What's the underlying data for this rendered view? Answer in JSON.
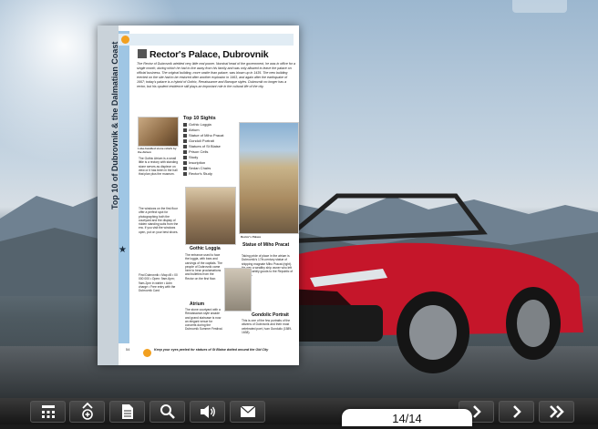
{
  "book": {
    "section_title": "Top 10 of Dubrovnik & the Dalmatian Coast",
    "heading": "Rector's Palace, Dubrovnik",
    "intro": "The Rector of Dubrovnik wielded very little real power. Nominal head of the government, he was in office for a single month, during which he had to live away from his family and was only allowed to leave the palace on official business. The original building, more castle than palace, was blown up in 1435. The new building erected on the site had to be restored after another explosion in 1463, and again after the earthquake of 1667; today's palace is a hybrid of Gothic, Renaissance and Baroque styles. Dubrovnik no longer has a rector, but his opulent residence still plays an important role in the cultural life of the city.",
    "top_sights_heading": "Top 10 Sights",
    "top_sights": [
      "Gothic Loggia",
      "Atrium",
      "Statue of Miho Pracat",
      "Gondoli Portrait",
      "Statues of St Blaise",
      "Prison Cells",
      "Study",
      "Inscription",
      "Sedan Chairs",
      "Rector's Study"
    ],
    "left_col_1": "The Gothic Atrium is a small little is a rectory with standing stone serves as dispiece on view or it has been in the hall that plan plus the museum.",
    "left_col_2": "The windows on the first floor offer a perfect spot for photographing both the courtyard and the display of ridden standing suits from the era. If you visit the windows open, put on your best shoes.",
    "left_col_3": "Find Dubrovnik • Map d5 • 00 000 000 • Open: 9am-6pm; 9am-2pm in winter • Adm charge • Free entry with the Dubrovnik Card",
    "caption_arch": "Lobe-handled stone reliefs by the Atrium",
    "caption_palace": "Rector's Palace",
    "gothic_loggia_h": "Gothic Loggia",
    "gothic_loggia_t": "The entrance used to face the loggia, with bars and carvings of the capitals. The people of Dubrovnik came here to hear proclamations and bulletins from the Rector on the first floor.",
    "atrium_h": "Atrium",
    "atrium_t": "The stone courtyard with a Renaissance-style arcade and grand staircase is now an elegant venue for concerts during the Dubrovnik Summer Festival.",
    "statue_h": "Statue of Miho Pracat",
    "statue_t": "Taking pride of place in the atrium is Dubrovnik's 17th-century statue of shipping magnate Miho Pracat (right). He was a wealthy ship owner who left all his worldly goods to the Republic of Ragusa.",
    "portrait_h": "Gondolic Portrait",
    "portrait_t": "This is one of the few portraits of the citizens of Dubrovnik and their most celebrated poet, Ivan Gundulic (1589-1638).",
    "page_number": "54",
    "footer_note": "Keep your eyes peeled for statues of St Blaise dotted around the Old City"
  },
  "toolbar": {
    "buttons": [
      "thumbnails",
      "zoom-in",
      "text",
      "search",
      "sound",
      "share"
    ],
    "nav_buttons": [
      "next",
      "last"
    ],
    "page_indicator": "14/14"
  }
}
